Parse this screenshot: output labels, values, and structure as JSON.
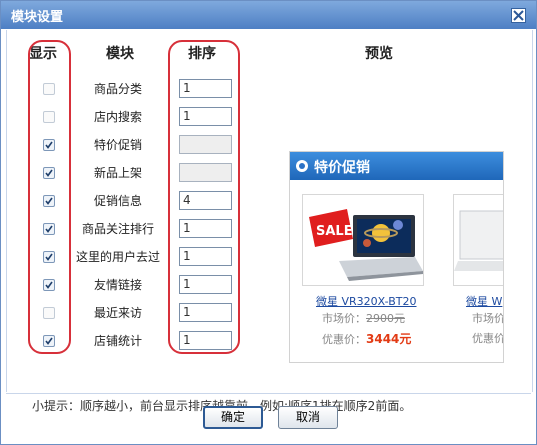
{
  "dialog": {
    "title": "模块设置"
  },
  "columns": {
    "show": "显示",
    "module": "模块",
    "order": "排序",
    "preview": "预览"
  },
  "modules": [
    {
      "name": "商品分类",
      "checked": false,
      "order": "1",
      "order_disabled": false
    },
    {
      "name": "店内搜索",
      "checked": false,
      "order": "1",
      "order_disabled": false
    },
    {
      "name": "特价促销",
      "checked": true,
      "order": "",
      "order_disabled": true
    },
    {
      "name": "新品上架",
      "checked": true,
      "order": "",
      "order_disabled": true
    },
    {
      "name": "促销信息",
      "checked": true,
      "order": "4",
      "order_disabled": false
    },
    {
      "name": "商品关注排行",
      "checked": true,
      "order": "1",
      "order_disabled": false
    },
    {
      "name": "这里的用户去过",
      "checked": true,
      "order": "1",
      "order_disabled": false
    },
    {
      "name": "友情链接",
      "checked": true,
      "order": "1",
      "order_disabled": false
    },
    {
      "name": "最近来访",
      "checked": false,
      "order": "1",
      "order_disabled": false
    },
    {
      "name": "店铺统计",
      "checked": true,
      "order": "1",
      "order_disabled": false
    }
  ],
  "preview": {
    "header": "特价促销",
    "products": [
      {
        "name": "微星 VR320X-BT20",
        "market_label": "市场价：",
        "market_price": "2900元",
        "sale_label": "优惠价：",
        "sale_price": "3444元",
        "badge": "SALE"
      },
      {
        "name": "微星 W",
        "market_label": "市场价",
        "market_price": "",
        "sale_label": "优惠价",
        "sale_price": ""
      }
    ]
  },
  "hint": "小提示：顺序越小，前台显示排序越靠前。例如:顺序1排在顺序2前面。",
  "buttons": {
    "ok": "确定",
    "cancel": "取消"
  },
  "colors": {
    "title_bar": "#4d7fc4",
    "highlight_oval": "#d7303a",
    "preview_header": "#1f67b9",
    "sale_price": "#e23a14"
  }
}
